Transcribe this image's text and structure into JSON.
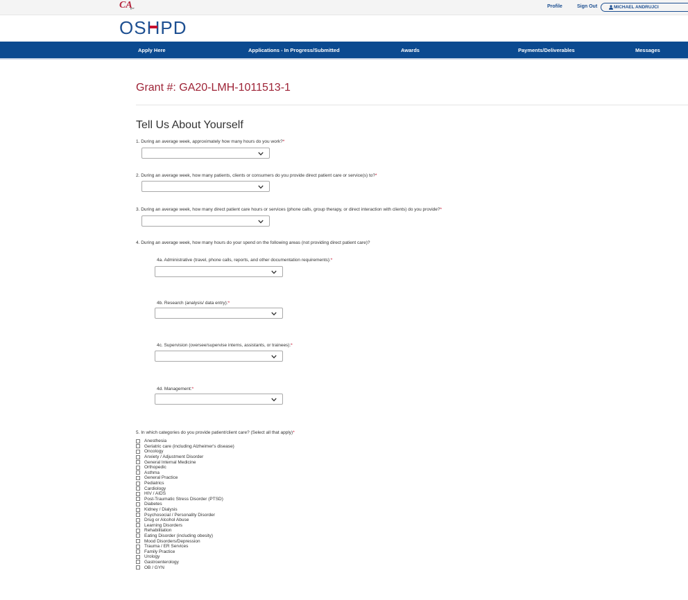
{
  "header": {
    "ca_logo": "CA",
    "ca_logo_sub": "gov",
    "profile": "Profile",
    "sign_out": "Sign Out",
    "user_name": "MICHAEL ANDRUJCI",
    "brand": {
      "part1": "OS",
      "part2": "H",
      "part3": "PD"
    }
  },
  "nav": {
    "items": [
      "Apply Here",
      "Applications - In Progress/Submitted",
      "Awards",
      "Payments/Deliverables",
      "Messages"
    ]
  },
  "grant_title": "Grant #: GA20-LMH-1011513-1",
  "section_title": "Tell Us About Yourself",
  "questions": {
    "q1": "1. During an average week, approximately how many hours do you work?",
    "q2": "2. During an average week, how many patients, clients or consumers do you provide direct patient care or service(s) to?",
    "q3": "3. During an average week, how many direct patient care hours or services (phone calls, group therapy, or direct interaction with clients) do you provide?",
    "q4": "4. During an average week, how many hours do your spend on the following areas (not providing direct patient care)?",
    "q4a": "4a. Administrative (travel, phone calls, reports, and other documentation requirements):",
    "q4b": "4b. Research (analysis/ data entry):",
    "q4c": "4c. Supervision (oversee/supervise interns, assistants, or trainees):",
    "q4d": "4d. Management:",
    "q5": "5. In which categories do you provide patient/client care? (Select all that apply)"
  },
  "required_mark": "*",
  "categories": [
    "Anesthesia",
    "Geriatric care (including Alzheimer's disease)",
    "Oncology",
    "Anxiety / Adjustment Disorder",
    "General Internal Medicine",
    "Orthopedic",
    "Asthma",
    "General Practice",
    "Pediatrics",
    "Cardiology",
    "HIV / AIDS",
    "Post-Traumatic Stress Disorder (PTSD)",
    "Diabetes",
    "Kidney / Dialysis",
    "Psychosocial / Personality Disorder",
    "Drug or Alcohol Abuse",
    "Learning Disorders",
    "Rehabilitation",
    "Eating Disorder (including obesity)",
    "Mood Disorders/Depression",
    "Trauma / ER Services",
    "Family Practice",
    "Urology",
    "Gastroenterology",
    "OB / GYN"
  ],
  "colors": {
    "nav_bg": "#0b4a90",
    "brand_blue": "#1d4f91",
    "brand_red": "#c8102e",
    "grant_red": "#9d2235"
  }
}
